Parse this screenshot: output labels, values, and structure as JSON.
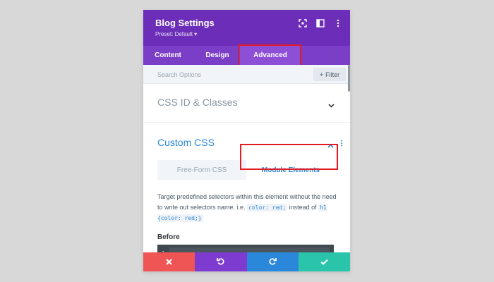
{
  "header": {
    "title": "Blog Settings",
    "preset": "Preset: Default ▾",
    "bg": "#6c2eb9"
  },
  "tabs": [
    {
      "label": "Content",
      "active": false
    },
    {
      "label": "Design",
      "active": false
    },
    {
      "label": "Advanced",
      "active": true
    }
  ],
  "search": {
    "placeholder": "Search Options",
    "filter_label": "Filter"
  },
  "sections": {
    "css_id": {
      "title": "CSS ID & Classes",
      "expanded": false
    },
    "custom_css": {
      "title": "Custom CSS",
      "expanded": true
    }
  },
  "subtabs": [
    {
      "label": "Free-Form CSS",
      "active": false
    },
    {
      "label": "Module Elements",
      "active": true
    }
  ],
  "description": {
    "text_1": "Target predefined selectors within this element without the need to write out selectors name. i.e.",
    "code_1": "color: red;",
    "text_2": "instead of",
    "code_2": "h1 {color: red;}"
  },
  "editor": {
    "label": "Before",
    "line_number": "1"
  },
  "footer": {
    "buttons": [
      {
        "icon": "close-icon",
        "color": "#ef5555"
      },
      {
        "icon": "undo-icon",
        "color": "#7e3bd0"
      },
      {
        "icon": "redo-icon",
        "color": "#2b87da"
      },
      {
        "icon": "check-icon",
        "color": "#29c4a9"
      }
    ]
  },
  "colors": {
    "accent": "#2b87da",
    "highlight": "#e31b23"
  }
}
